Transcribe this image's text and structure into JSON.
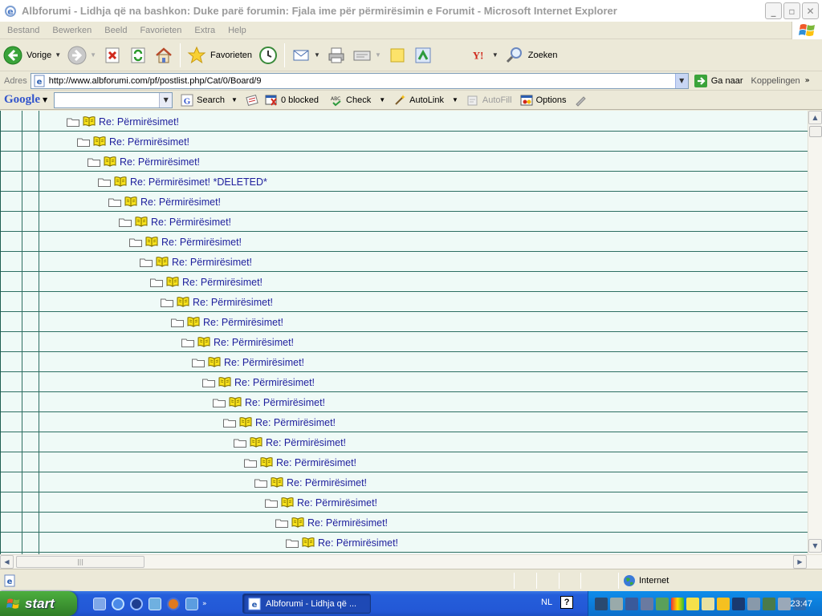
{
  "window": {
    "title": "Albforumi - Lidhja që na bashkon: Duke parë forumin: Fjala ime për përmirësimin e Forumit - Microsoft Internet Explorer"
  },
  "menu": {
    "items": [
      "Bestand",
      "Bewerken",
      "Beeld",
      "Favorieten",
      "Extra",
      "Help"
    ]
  },
  "toolbar": {
    "back_label": "Vorige",
    "favorites_label": "Favorieten",
    "search_label": "Zoeken"
  },
  "address": {
    "label": "Adres",
    "url": "http://www.albforumi.com/pf/postlist.php/Cat/0/Board/9",
    "go_label": "Ga naar",
    "links_label": "Koppelingen"
  },
  "google_toolbar": {
    "logo": "Google",
    "search_label": "Search",
    "blocked_label": "0 blocked",
    "check_label": "Check",
    "autolink_label": "AutoLink",
    "autofill_label": "AutoFill",
    "options_label": "Options"
  },
  "posts": [
    {
      "title": "Re: Përmirësimet!"
    },
    {
      "title": "Re: Përmirësimet!"
    },
    {
      "title": "Re: Përmirësimet!"
    },
    {
      "title": "Re: Përmirësimet! *DELETED*"
    },
    {
      "title": "Re: Përmirësimet!"
    },
    {
      "title": "Re: Përmirësimet!"
    },
    {
      "title": "Re: Përmirësimet!"
    },
    {
      "title": "Re: Përmirësimet!"
    },
    {
      "title": "Re: Përmirësimet!"
    },
    {
      "title": "Re: Përmirësimet!"
    },
    {
      "title": "Re: Përmirësimet!"
    },
    {
      "title": "Re: Përmirësimet!"
    },
    {
      "title": "Re: Përmirësimet!"
    },
    {
      "title": "Re: Përmirësimet!"
    },
    {
      "title": "Re: Përmirësimet!"
    },
    {
      "title": "Re: Përmirësimet!"
    },
    {
      "title": "Re: Përmirësimet!"
    },
    {
      "title": "Re: Përmirësimet!"
    },
    {
      "title": "Re: Përmirësimet!"
    },
    {
      "title": "Re: Përmirësimet!"
    },
    {
      "title": "Re: Përmirësimet!"
    },
    {
      "title": "Re: Përmirësimet!"
    }
  ],
  "statusbar": {
    "zone_label": "Internet"
  },
  "taskbar": {
    "start_label": "start",
    "window_label": "Albforumi - Lidhja që ...",
    "language": "NL",
    "help_glyph": "?",
    "clock": "23:47"
  },
  "icons": {
    "title": "ie-icon",
    "back": "back-arrow-icon",
    "forward": "forward-arrow-icon",
    "stop": "stop-icon",
    "refresh": "refresh-icon",
    "home": "home-icon",
    "favorites": "star-icon",
    "history": "history-icon",
    "mail": "mail-icon",
    "print": "printer-icon",
    "edit": "edit-icon",
    "messenger": "note-icon",
    "folder": "folder-icon",
    "book": "open-book-icon"
  },
  "colors": {
    "content_bg": "#EFFAF7",
    "row_line": "#2D6E62",
    "link": "#1D1D9C"
  }
}
